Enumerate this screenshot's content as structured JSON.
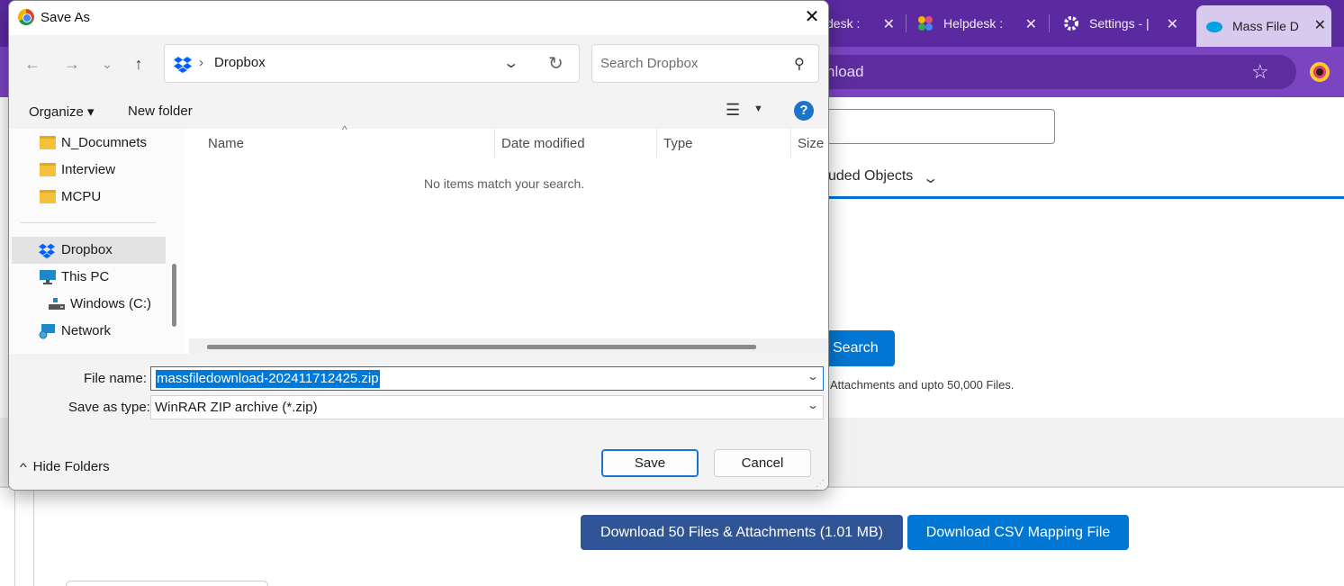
{
  "browser": {
    "tabs": [
      {
        "label": "desk :",
        "icon": "helpdesk-icon"
      },
      {
        "label": "Helpdesk :",
        "icon": "helpdesk-icon"
      },
      {
        "label": "Settings - |",
        "icon": "gear-icon"
      },
      {
        "label": "Mass File D",
        "icon": "salesforce-cloud-icon",
        "active": true
      }
    ],
    "tab_close_glyph": "✕",
    "omnibox_text": "nload"
  },
  "page": {
    "included_objects_label": "uded Objects",
    "search_button": "Search",
    "note": "Attachments and upto 50,000 Files.",
    "download_files_button": "Download 50 Files & Attachments (1.01 MB)",
    "download_csv_button": "Download CSV Mapping File"
  },
  "dialog": {
    "title": "Save As",
    "address": {
      "location": "Dropbox",
      "separator": "›"
    },
    "search_placeholder": "Search Dropbox",
    "toolbar": {
      "organize": "Organize ▾",
      "new_folder": "New folder",
      "help": "?"
    },
    "sidebar": {
      "items": [
        {
          "label": "N_Documnets",
          "icon": "folder-icon"
        },
        {
          "label": "Interview",
          "icon": "folder-icon"
        },
        {
          "label": "MCPU",
          "icon": "folder-icon"
        },
        {
          "label": "Dropbox",
          "icon": "dropbox-icon",
          "selected": true
        },
        {
          "label": "This PC",
          "icon": "computer-icon"
        },
        {
          "label": "Windows (C:)",
          "icon": "drive-icon"
        },
        {
          "label": "Network",
          "icon": "network-icon"
        }
      ]
    },
    "columns": [
      "Name",
      "Date modified",
      "Type",
      "Size"
    ],
    "empty_message": "No items match your search.",
    "file_name_label": "File name:",
    "file_name_value": "massfiledownload-202411712425.zip",
    "save_type_label": "Save as type:",
    "save_type_value": "WinRAR ZIP archive (*.zip)",
    "hide_folders": "Hide Folders",
    "save_button": "Save",
    "cancel_button": "Cancel"
  },
  "colors": {
    "browser_frame": "#5b2aa0",
    "browser_toolbar": "#7b45c2",
    "accent_blue": "#0176d3",
    "dark_blue_button": "#2f5597",
    "selection_blue": "#0078d7"
  }
}
